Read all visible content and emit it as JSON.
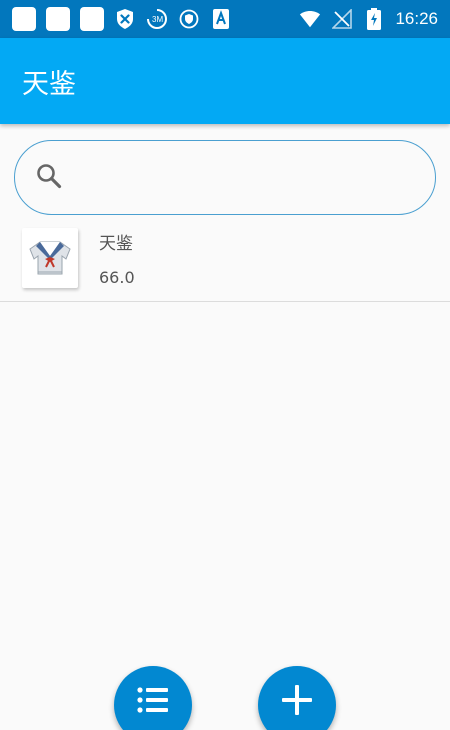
{
  "status_bar": {
    "time": "16:26",
    "left_icons": [
      "app-square-1",
      "app-square-2",
      "app-square-3",
      "shield-x-icon",
      "app-logo-icon",
      "vpn-shield-icon",
      "text-a-icon"
    ],
    "right_icons": [
      "wifi-icon",
      "no-signal-icon",
      "battery-charging-icon"
    ]
  },
  "toolbar": {
    "title": "天鉴"
  },
  "search": {
    "placeholder": "",
    "value": ""
  },
  "list": {
    "items": [
      {
        "name": "天鉴",
        "price": "66.0",
        "icon": "sailor-shirt-icon"
      }
    ]
  },
  "fabs": {
    "list_icon": "list-icon",
    "add_icon": "plus-icon"
  },
  "colors": {
    "status_bar": "#0277bd",
    "toolbar": "#03a9f4",
    "fab": "#0288d1",
    "search_border": "#4a9fd0"
  }
}
